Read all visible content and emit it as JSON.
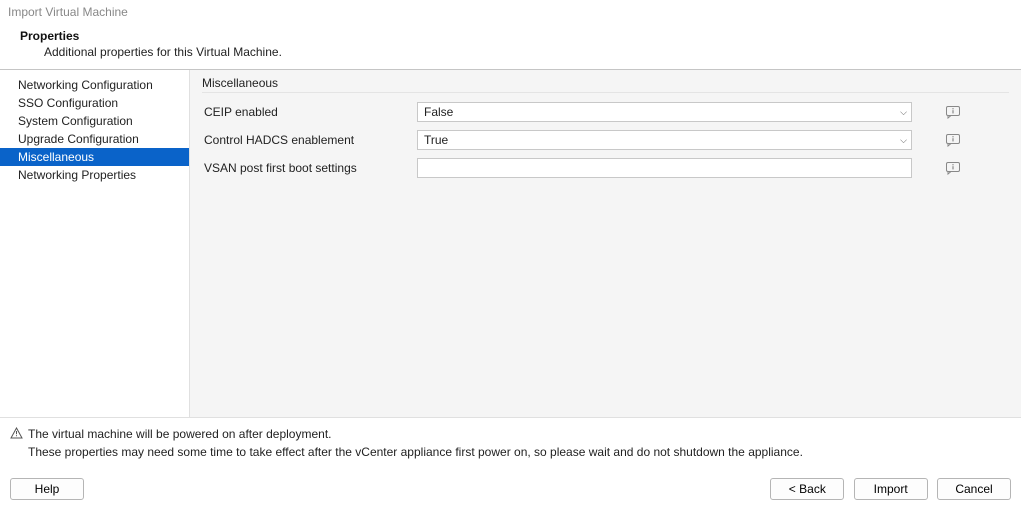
{
  "window": {
    "title": "Import Virtual Machine"
  },
  "header": {
    "title": "Properties",
    "subtitle": "Additional properties for this Virtual Machine."
  },
  "sidebar": {
    "items": [
      {
        "label": "Networking Configuration",
        "selected": false
      },
      {
        "label": "SSO Configuration",
        "selected": false
      },
      {
        "label": "System Configuration",
        "selected": false
      },
      {
        "label": "Upgrade Configuration",
        "selected": false
      },
      {
        "label": "Miscellaneous",
        "selected": true
      },
      {
        "label": "Networking Properties",
        "selected": false
      }
    ]
  },
  "panel": {
    "group_label": "Miscellaneous",
    "rows": [
      {
        "label": "CEIP enabled",
        "type": "select",
        "value": "False"
      },
      {
        "label": "Control HADCS enablement",
        "type": "select",
        "value": "True"
      },
      {
        "label": "VSAN post first boot settings",
        "type": "text",
        "value": ""
      }
    ]
  },
  "notes": {
    "line1": "The virtual machine will be powered on after deployment.",
    "line2": "These properties may need some time to take effect after the vCenter appliance first power on, so please wait and do not shutdown the appliance."
  },
  "buttons": {
    "help": "Help",
    "back": "< Back",
    "import": "Import",
    "cancel": "Cancel"
  }
}
